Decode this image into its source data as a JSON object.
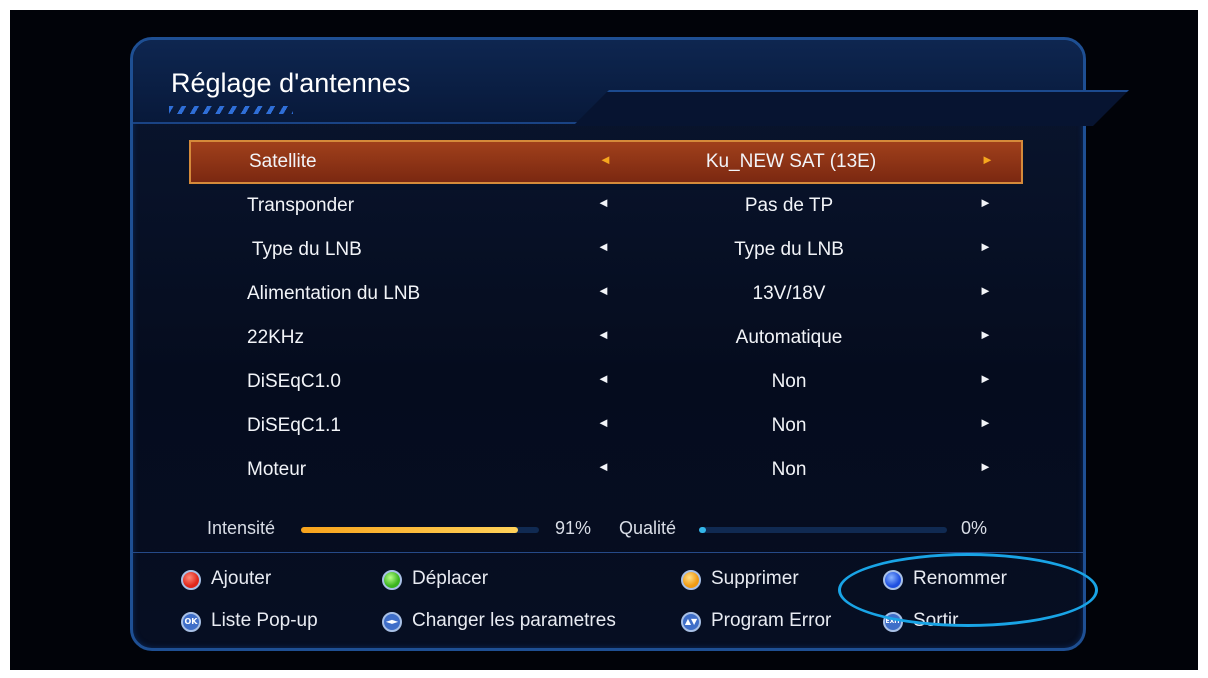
{
  "screen": {
    "title": "Réglage d'antennes"
  },
  "menu": {
    "rows": [
      {
        "label": "Satellite",
        "value": "Ku_NEW SAT (13E)",
        "selected": true
      },
      {
        "label": "Transponder",
        "value": "Pas de TP"
      },
      {
        "label": " Type du LNB",
        "value": "Type du LNB"
      },
      {
        "label": "Alimentation du LNB",
        "value": "13V/18V"
      },
      {
        "label": "22KHz",
        "value": "Automatique"
      },
      {
        "label": "DiSEqC1.0",
        "value": "Non"
      },
      {
        "label": "DiSEqC1.1",
        "value": "Non"
      },
      {
        "label": "Moteur",
        "value": "Non"
      }
    ],
    "arrow_left": "◄",
    "arrow_right": "►"
  },
  "signal": {
    "intensity_label": "Intensité",
    "intensity_value": "91%",
    "intensity_level": 0.91,
    "quality_label": "Qualité",
    "quality_value": "0%",
    "quality_level": 0.0
  },
  "footer": {
    "red": {
      "label": "Ajouter",
      "icon": "red-button-icon"
    },
    "green": {
      "label": "Déplacer",
      "icon": "green-button-icon"
    },
    "yellow": {
      "label": "Supprimer",
      "icon": "yellow-button-icon"
    },
    "blue": {
      "label": "Renommer",
      "icon": "blue-button-icon"
    },
    "ok": {
      "label": "Liste Pop-up",
      "icon_text": "OK"
    },
    "left_right": {
      "label": "Changer les parametres",
      "icon_text": "◄►"
    },
    "up_down": {
      "label": "Program Error",
      "icon_text": "▲▼"
    },
    "exit": {
      "label": "Sortir",
      "icon_text": "EXIT"
    }
  },
  "colors": {
    "selected_row": "#8f3415",
    "intensity_bar": "#f7a31c",
    "quality_bar": "#33b7ea",
    "highlight_ring": "#19a4e6"
  }
}
